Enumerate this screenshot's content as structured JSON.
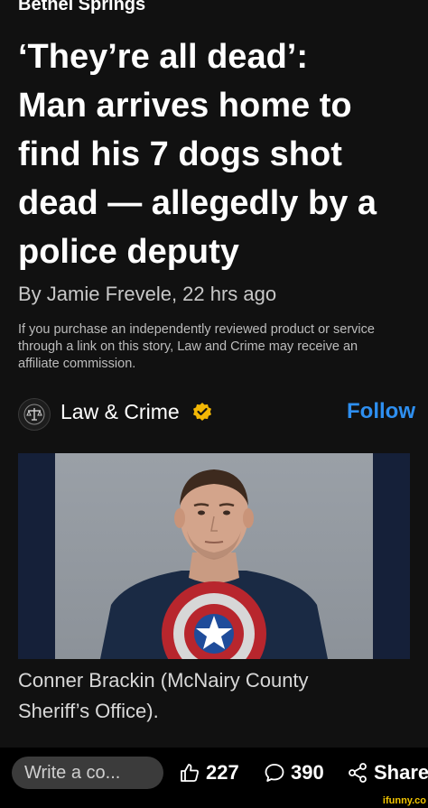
{
  "article": {
    "section_label": "Bethel Springs",
    "headline_lines": [
      "‘They’re all dead’:",
      "Man arrives home to",
      "find his 7 dogs shot",
      "dead — allegedly by a",
      "police deputy"
    ],
    "byline": "By Jamie Frevele, 22 hrs ago",
    "disclaimer_lines": [
      "If you purchase an independently reviewed product or service",
      "through a link on this story, Law and Crime may receive an",
      "affiliate commission."
    ]
  },
  "publisher": {
    "name": "Law & Crime",
    "follow_label": "Follow",
    "logo_icon": "scales-of-justice-icon",
    "verified_icon": "verified-badge-icon",
    "follow_color": "#2e8ff0",
    "verified_color": "#f2b705"
  },
  "photo": {
    "caption_lines": [
      "Conner Brackin (McNairy County",
      "Sheriff’s Office)."
    ]
  },
  "bottom_bar": {
    "comment_placeholder": "Write a co...",
    "like_count": "227",
    "comment_count": "390",
    "share_label": "Share",
    "like_icon": "thumbs-up-icon",
    "comment_icon": "speech-bubble-icon",
    "share_icon": "share-icon"
  },
  "watermark": "ifunny.co"
}
